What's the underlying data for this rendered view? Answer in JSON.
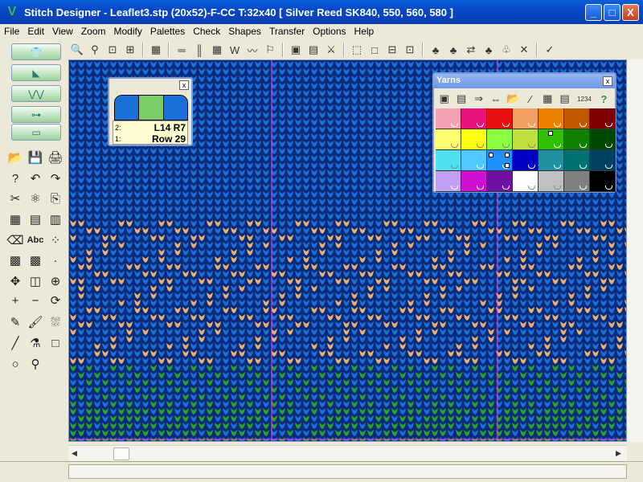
{
  "window": {
    "title": "Stitch Designer - Leaflet3.stp (20x52)-F-CC     T:32x40     [ Silver Reed SK840, 550, 560, 580 ]",
    "minimize": "_",
    "maximize": "□",
    "close": "X"
  },
  "menu": [
    "File",
    "Edit",
    "View",
    "Zoom",
    "Modify",
    "Palettes",
    "Check",
    "Shapes",
    "Transfer",
    "Options",
    "Help"
  ],
  "toolbar_top": [
    {
      "name": "zoom-in-icon",
      "glyph": "🔍"
    },
    {
      "name": "zoom-out-icon",
      "glyph": "⚲"
    },
    {
      "name": "zoom-fit-icon",
      "glyph": "⊡"
    },
    {
      "name": "zoom-window-icon",
      "glyph": "⊞"
    },
    {
      "sep": true
    },
    {
      "name": "machine-icon",
      "glyph": "▦"
    },
    {
      "sep": true
    },
    {
      "name": "ruler-h-icon",
      "glyph": "═"
    },
    {
      "name": "ruler-v-icon",
      "glyph": "║"
    },
    {
      "name": "grid-icon",
      "glyph": "▦"
    },
    {
      "name": "stitch-view-icon",
      "glyph": "W"
    },
    {
      "name": "rainbow-icon",
      "glyph": "〰"
    },
    {
      "name": "pattern-icon",
      "glyph": "⚐"
    },
    {
      "sep": true
    },
    {
      "name": "palette-icon",
      "glyph": "▣"
    },
    {
      "name": "palette2-icon",
      "glyph": "▤"
    },
    {
      "name": "cross-icon",
      "glyph": "⚔"
    },
    {
      "sep": true
    },
    {
      "name": "select-icon",
      "glyph": "⬚"
    },
    {
      "name": "select-rect-icon",
      "glyph": "□"
    },
    {
      "name": "select-all-icon",
      "glyph": "⊟"
    },
    {
      "name": "select-ext-icon",
      "glyph": "⊡"
    },
    {
      "sep": true
    },
    {
      "name": "garment1-icon",
      "glyph": "♣"
    },
    {
      "name": "garment2-icon",
      "glyph": "♣"
    },
    {
      "name": "garment3-icon",
      "glyph": "⇄"
    },
    {
      "name": "garment4-icon",
      "glyph": "♣"
    },
    {
      "name": "garment5-icon",
      "glyph": "♧"
    },
    {
      "name": "garment-off-icon",
      "glyph": "✕"
    },
    {
      "sep": true
    },
    {
      "name": "check-icon",
      "glyph": "✓"
    }
  ],
  "left_big_tools": [
    {
      "name": "sweater-tool",
      "glyph": "👕"
    },
    {
      "name": "diagonal-tool",
      "glyph": "◣"
    },
    {
      "name": "pattern-tool",
      "glyph": "⋁⋁"
    },
    {
      "name": "machine-tool",
      "glyph": "⊶"
    },
    {
      "name": "tape-tool",
      "glyph": "▭"
    }
  ],
  "left_tools": [
    {
      "name": "open-icon",
      "glyph": "📂"
    },
    {
      "name": "save-icon",
      "glyph": "💾"
    },
    {
      "name": "print-icon",
      "glyph": "🖨"
    },
    {
      "name": "help-icon",
      "glyph": "?"
    },
    {
      "name": "undo-icon",
      "glyph": "↶"
    },
    {
      "name": "redo-icon",
      "glyph": "↷"
    },
    {
      "name": "cut-icon",
      "glyph": "✂"
    },
    {
      "name": "camera-icon",
      "glyph": "⚛"
    },
    {
      "name": "paste-icon",
      "glyph": "⎘"
    },
    {
      "name": "grid-a-icon",
      "glyph": "▦"
    },
    {
      "name": "grid-b-icon",
      "glyph": "▤"
    },
    {
      "name": "grid-c-icon",
      "glyph": "▥"
    },
    {
      "name": "erase-icon",
      "glyph": "⌫"
    },
    {
      "name": "text-icon",
      "glyph": "Abc"
    },
    {
      "name": "scatter-icon",
      "glyph": "⁘"
    },
    {
      "name": "tile-a-icon",
      "glyph": "▩"
    },
    {
      "name": "tile-b-icon",
      "glyph": "▩"
    },
    {
      "name": "dot-icon",
      "glyph": "·"
    },
    {
      "name": "move-icon",
      "glyph": "✥"
    },
    {
      "name": "mirror-icon",
      "glyph": "◫"
    },
    {
      "name": "rotate-icon",
      "glyph": "⊕"
    },
    {
      "name": "plus-icon",
      "glyph": "+"
    },
    {
      "name": "minus-icon",
      "glyph": "−"
    },
    {
      "name": "lasso-icon",
      "glyph": "⟳"
    },
    {
      "name": "pencil-icon",
      "glyph": "✎"
    },
    {
      "name": "brush-icon",
      "glyph": "🖌"
    },
    {
      "name": "spray-icon",
      "glyph": "⛆"
    },
    {
      "name": "line-icon",
      "glyph": "╱"
    },
    {
      "name": "fill-icon",
      "glyph": "⚗"
    },
    {
      "name": "rect-icon",
      "glyph": "□"
    },
    {
      "name": "circle-icon",
      "glyph": "○"
    },
    {
      "name": "eyedropper-icon",
      "glyph": "⚲"
    }
  ],
  "yarn_panel": {
    "close": "x",
    "swatches": [
      "#1a6fd8",
      "#7ccc66",
      "#1a6fd8"
    ],
    "rows": [
      {
        "num": "2:",
        "value": "L14 R7"
      },
      {
        "num": "1:",
        "value": "Row 29"
      }
    ]
  },
  "yarns_window": {
    "title": "Yarns",
    "close": "x",
    "toolbar": [
      {
        "name": "yw-palette-icon",
        "glyph": "▣"
      },
      {
        "name": "yw-palette2-icon",
        "glyph": "▤"
      },
      {
        "name": "yw-arrow-icon",
        "glyph": "⇒"
      },
      {
        "name": "yw-swap-icon",
        "glyph": "⇔"
      },
      {
        "name": "yw-open-icon",
        "glyph": "📂"
      },
      {
        "name": "yw-mix-icon",
        "glyph": "⁄"
      },
      {
        "name": "yw-grid-icon",
        "glyph": "▦"
      },
      {
        "name": "yw-list-icon",
        "glyph": "▤"
      },
      {
        "name": "yw-number-icon",
        "glyph": "1234"
      },
      {
        "name": "yw-help-icon",
        "glyph": "?"
      }
    ],
    "colors": [
      "#f4a0b4",
      "#e8147c",
      "#e81010",
      "#f0a060",
      "#f08000",
      "#c05800",
      "#800000",
      "#ffff70",
      "#ffff10",
      "#8cff40",
      "#c0e040",
      "#30c000",
      "#108000",
      "#004800",
      "#50e0f0",
      "#50c8ff",
      "#1e90ff",
      "#0000c0",
      "#2090a0",
      "#007070",
      "#004060",
      "#c0a0f0",
      "#d010d0",
      "#7010a0",
      "#ffffff",
      "#c0c0c0",
      "#808080",
      "#000000"
    ]
  },
  "colors": {
    "knit_blue": "#1a6fd8",
    "knit_gap": "#0a2a7a",
    "leaf": "#e8b070",
    "grass": "#2ca02c",
    "guide": "#ff40ff"
  }
}
